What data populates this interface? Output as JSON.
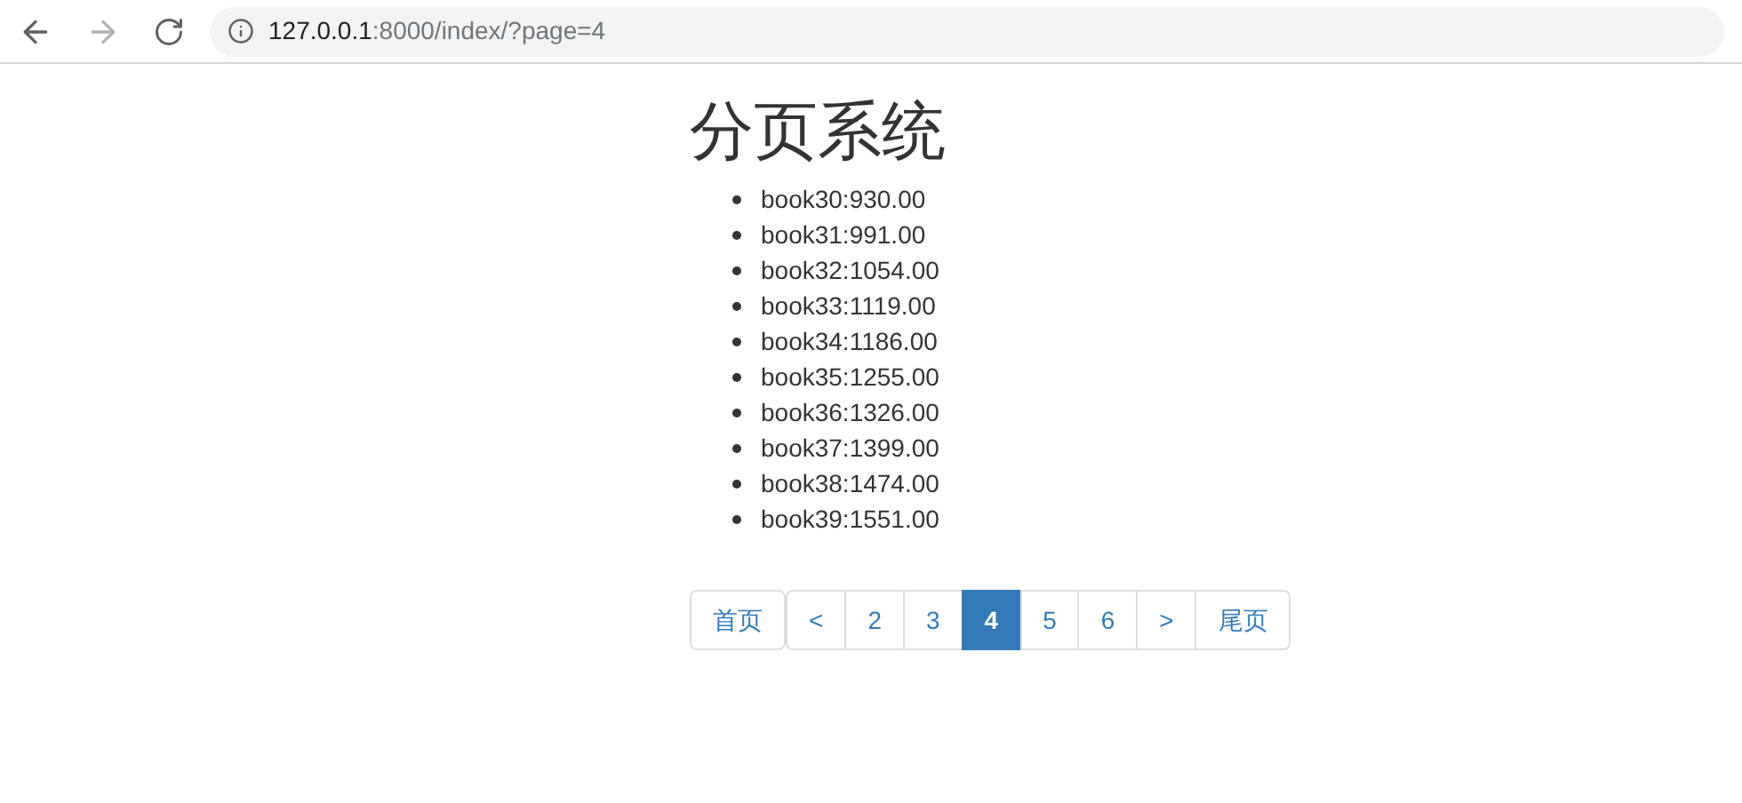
{
  "browser": {
    "back": {
      "disabled": false
    },
    "forward": {
      "disabled": true
    },
    "url_host": "127.0.0.1",
    "url_rest": ":8000/index/?page=4"
  },
  "title": "分页系统",
  "items": [
    "book30:930.00",
    "book31:991.00",
    "book32:1054.00",
    "book33:1119.00",
    "book34:1186.00",
    "book35:1255.00",
    "book36:1326.00",
    "book37:1399.00",
    "book38:1474.00",
    "book39:1551.00"
  ],
  "pagination": {
    "first": "首页",
    "pages": [
      {
        "label": "<",
        "selected": false
      },
      {
        "label": "2",
        "selected": false
      },
      {
        "label": "3",
        "selected": false
      },
      {
        "label": "4",
        "selected": true
      },
      {
        "label": "5",
        "selected": false
      },
      {
        "label": "6",
        "selected": false
      },
      {
        "label": ">",
        "selected": false
      }
    ],
    "last": "尾页"
  }
}
